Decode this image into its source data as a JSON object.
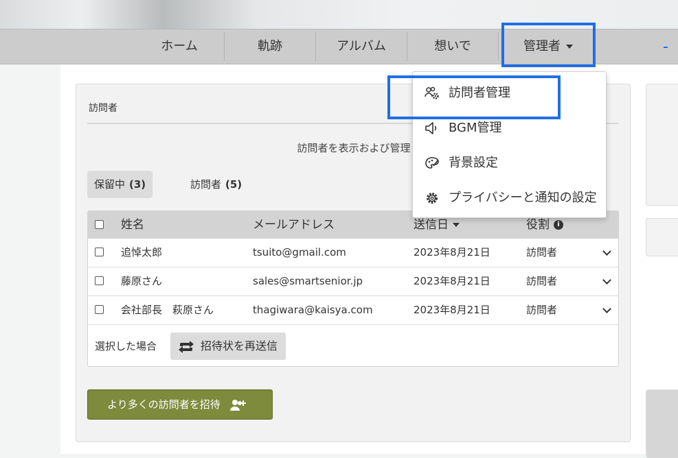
{
  "nav": {
    "items": [
      {
        "label": "ホーム"
      },
      {
        "label": "軌跡"
      },
      {
        "label": "アルバム"
      },
      {
        "label": "想いで"
      },
      {
        "label": "管理者"
      }
    ],
    "extra_marker": "-"
  },
  "dropdown": {
    "items": [
      {
        "label": "訪問者管理",
        "icon": "users-gear-icon"
      },
      {
        "label": "BGM管理",
        "icon": "speaker-icon"
      },
      {
        "label": "背景設定",
        "icon": "palette-icon"
      },
      {
        "label": "プライバシーと通知の設定",
        "icon": "gear-icon"
      }
    ]
  },
  "panel": {
    "title": "訪問者",
    "subtitle": "訪問者を表示および管理"
  },
  "tabs": [
    {
      "label": "保留中",
      "count": "(3)"
    },
    {
      "label": "訪問者",
      "count": "(5)"
    }
  ],
  "table": {
    "headers": {
      "name": "姓名",
      "email": "メールアドレス",
      "sent_date": "送信日",
      "role": "役割"
    },
    "rows": [
      {
        "name": "追悼太郎",
        "email": "tsuito@gmail.com",
        "sent_date": "2023年8月21日",
        "role": "訪問者"
      },
      {
        "name": "藤原さん",
        "email": "sales@smartsenior.jp",
        "sent_date": "2023年8月21日",
        "role": "訪問者"
      },
      {
        "name": "会社部長　萩原さん",
        "email": "thagiwara@kaisya.com",
        "sent_date": "2023年8月21日",
        "role": "訪問者"
      }
    ],
    "footer": {
      "selected_label": "選択した場合",
      "resend_label": "招待状を再送信"
    }
  },
  "invite_button": {
    "label": "より多くの訪問者を招待"
  },
  "colors": {
    "highlight": "#1f6fe5",
    "invite_button": "#7e8a3c",
    "navbar": "#cccccc"
  }
}
